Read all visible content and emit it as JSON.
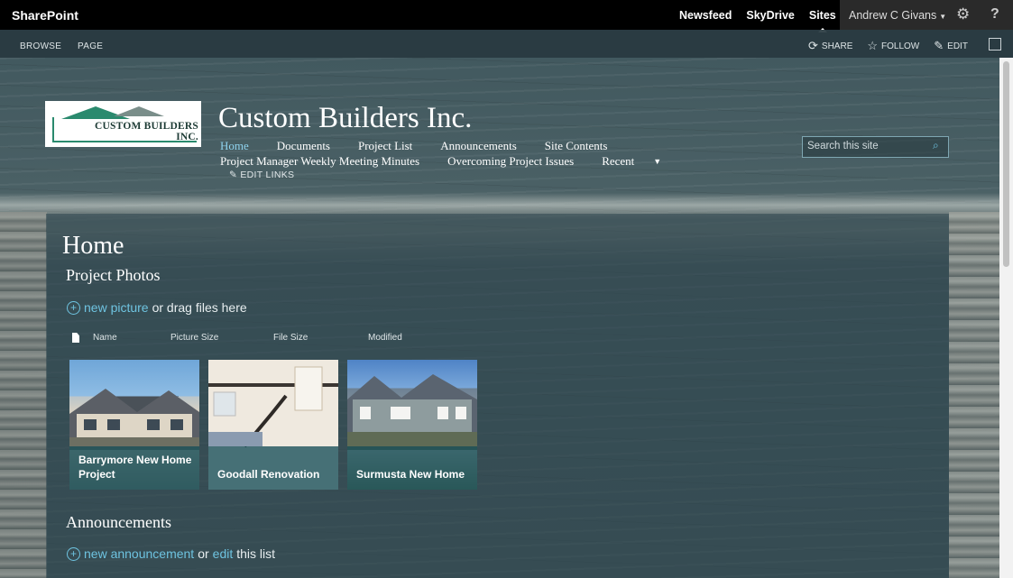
{
  "suitebar": {
    "brand": "SharePoint",
    "links": [
      "Newsfeed",
      "SkyDrive",
      "Sites"
    ],
    "user": "Andrew C Givans",
    "help": "?"
  },
  "ribbon": {
    "tabs": [
      "BROWSE",
      "PAGE"
    ],
    "share": "SHARE",
    "follow": "FOLLOW",
    "edit": "EDIT"
  },
  "header": {
    "logo_text_line1": "CUSTOM BUILDERS",
    "logo_text_line2": "INC.",
    "site_title": "Custom Builders Inc.",
    "nav_row1": [
      "Home",
      "Documents",
      "Project List",
      "Announcements",
      "Site Contents"
    ],
    "nav_row2": [
      "Project Manager Weekly Meeting Minutes",
      "Overcoming Project Issues",
      "Recent"
    ],
    "edit_links": "EDIT LINKS",
    "search_placeholder": "Search this site"
  },
  "main": {
    "page_title": "Home",
    "photos": {
      "title": "Project Photos",
      "new_link": "new picture",
      "new_suffix": "or drag files here",
      "columns": [
        "Name",
        "Picture Size",
        "File Size",
        "Modified"
      ],
      "tiles": [
        {
          "caption": "Barrymore New Home Project"
        },
        {
          "caption": "Goodall Renovation"
        },
        {
          "caption": "Surmusta New Home"
        }
      ]
    },
    "announcements": {
      "title": "Announcements",
      "new_link": "new announcement",
      "or": "or",
      "edit_link": "edit",
      "suffix": "this list"
    }
  },
  "colors": {
    "accent": "#6ec3e0",
    "suitebar": "#000000",
    "panel": "#344a52"
  }
}
